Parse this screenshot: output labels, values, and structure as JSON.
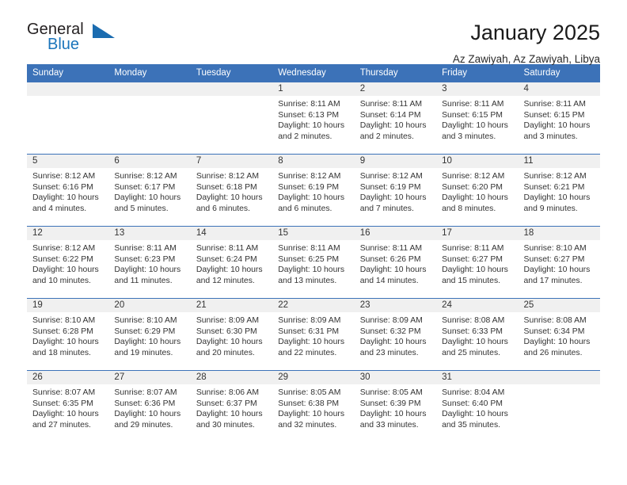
{
  "brand": {
    "name_part1": "General",
    "name_part2": "Blue",
    "triangle_color": "#1b6cb0",
    "blue_color": "#1b75bb"
  },
  "header": {
    "month_title": "January 2025",
    "location": "Az Zawiyah, Az Zawiyah, Libya"
  },
  "theme": {
    "header_blue": "#3c72b8",
    "band_gray": "#f0f0f0",
    "text": "#333333"
  },
  "calendar": {
    "weekday_headers": [
      "Sunday",
      "Monday",
      "Tuesday",
      "Wednesday",
      "Thursday",
      "Friday",
      "Saturday"
    ],
    "weeks": [
      [
        {
          "day": "",
          "lines": []
        },
        {
          "day": "",
          "lines": []
        },
        {
          "day": "",
          "lines": []
        },
        {
          "day": "1",
          "lines": [
            "Sunrise: 8:11 AM",
            "Sunset: 6:13 PM",
            "Daylight: 10 hours",
            "and 2 minutes."
          ]
        },
        {
          "day": "2",
          "lines": [
            "Sunrise: 8:11 AM",
            "Sunset: 6:14 PM",
            "Daylight: 10 hours",
            "and 2 minutes."
          ]
        },
        {
          "day": "3",
          "lines": [
            "Sunrise: 8:11 AM",
            "Sunset: 6:15 PM",
            "Daylight: 10 hours",
            "and 3 minutes."
          ]
        },
        {
          "day": "4",
          "lines": [
            "Sunrise: 8:11 AM",
            "Sunset: 6:15 PM",
            "Daylight: 10 hours",
            "and 3 minutes."
          ]
        }
      ],
      [
        {
          "day": "5",
          "lines": [
            "Sunrise: 8:12 AM",
            "Sunset: 6:16 PM",
            "Daylight: 10 hours",
            "and 4 minutes."
          ]
        },
        {
          "day": "6",
          "lines": [
            "Sunrise: 8:12 AM",
            "Sunset: 6:17 PM",
            "Daylight: 10 hours",
            "and 5 minutes."
          ]
        },
        {
          "day": "7",
          "lines": [
            "Sunrise: 8:12 AM",
            "Sunset: 6:18 PM",
            "Daylight: 10 hours",
            "and 6 minutes."
          ]
        },
        {
          "day": "8",
          "lines": [
            "Sunrise: 8:12 AM",
            "Sunset: 6:19 PM",
            "Daylight: 10 hours",
            "and 6 minutes."
          ]
        },
        {
          "day": "9",
          "lines": [
            "Sunrise: 8:12 AM",
            "Sunset: 6:19 PM",
            "Daylight: 10 hours",
            "and 7 minutes."
          ]
        },
        {
          "day": "10",
          "lines": [
            "Sunrise: 8:12 AM",
            "Sunset: 6:20 PM",
            "Daylight: 10 hours",
            "and 8 minutes."
          ]
        },
        {
          "day": "11",
          "lines": [
            "Sunrise: 8:12 AM",
            "Sunset: 6:21 PM",
            "Daylight: 10 hours",
            "and 9 minutes."
          ]
        }
      ],
      [
        {
          "day": "12",
          "lines": [
            "Sunrise: 8:12 AM",
            "Sunset: 6:22 PM",
            "Daylight: 10 hours",
            "and 10 minutes."
          ]
        },
        {
          "day": "13",
          "lines": [
            "Sunrise: 8:11 AM",
            "Sunset: 6:23 PM",
            "Daylight: 10 hours",
            "and 11 minutes."
          ]
        },
        {
          "day": "14",
          "lines": [
            "Sunrise: 8:11 AM",
            "Sunset: 6:24 PM",
            "Daylight: 10 hours",
            "and 12 minutes."
          ]
        },
        {
          "day": "15",
          "lines": [
            "Sunrise: 8:11 AM",
            "Sunset: 6:25 PM",
            "Daylight: 10 hours",
            "and 13 minutes."
          ]
        },
        {
          "day": "16",
          "lines": [
            "Sunrise: 8:11 AM",
            "Sunset: 6:26 PM",
            "Daylight: 10 hours",
            "and 14 minutes."
          ]
        },
        {
          "day": "17",
          "lines": [
            "Sunrise: 8:11 AM",
            "Sunset: 6:27 PM",
            "Daylight: 10 hours",
            "and 15 minutes."
          ]
        },
        {
          "day": "18",
          "lines": [
            "Sunrise: 8:10 AM",
            "Sunset: 6:27 PM",
            "Daylight: 10 hours",
            "and 17 minutes."
          ]
        }
      ],
      [
        {
          "day": "19",
          "lines": [
            "Sunrise: 8:10 AM",
            "Sunset: 6:28 PM",
            "Daylight: 10 hours",
            "and 18 minutes."
          ]
        },
        {
          "day": "20",
          "lines": [
            "Sunrise: 8:10 AM",
            "Sunset: 6:29 PM",
            "Daylight: 10 hours",
            "and 19 minutes."
          ]
        },
        {
          "day": "21",
          "lines": [
            "Sunrise: 8:09 AM",
            "Sunset: 6:30 PM",
            "Daylight: 10 hours",
            "and 20 minutes."
          ]
        },
        {
          "day": "22",
          "lines": [
            "Sunrise: 8:09 AM",
            "Sunset: 6:31 PM",
            "Daylight: 10 hours",
            "and 22 minutes."
          ]
        },
        {
          "day": "23",
          "lines": [
            "Sunrise: 8:09 AM",
            "Sunset: 6:32 PM",
            "Daylight: 10 hours",
            "and 23 minutes."
          ]
        },
        {
          "day": "24",
          "lines": [
            "Sunrise: 8:08 AM",
            "Sunset: 6:33 PM",
            "Daylight: 10 hours",
            "and 25 minutes."
          ]
        },
        {
          "day": "25",
          "lines": [
            "Sunrise: 8:08 AM",
            "Sunset: 6:34 PM",
            "Daylight: 10 hours",
            "and 26 minutes."
          ]
        }
      ],
      [
        {
          "day": "26",
          "lines": [
            "Sunrise: 8:07 AM",
            "Sunset: 6:35 PM",
            "Daylight: 10 hours",
            "and 27 minutes."
          ]
        },
        {
          "day": "27",
          "lines": [
            "Sunrise: 8:07 AM",
            "Sunset: 6:36 PM",
            "Daylight: 10 hours",
            "and 29 minutes."
          ]
        },
        {
          "day": "28",
          "lines": [
            "Sunrise: 8:06 AM",
            "Sunset: 6:37 PM",
            "Daylight: 10 hours",
            "and 30 minutes."
          ]
        },
        {
          "day": "29",
          "lines": [
            "Sunrise: 8:05 AM",
            "Sunset: 6:38 PM",
            "Daylight: 10 hours",
            "and 32 minutes."
          ]
        },
        {
          "day": "30",
          "lines": [
            "Sunrise: 8:05 AM",
            "Sunset: 6:39 PM",
            "Daylight: 10 hours",
            "and 33 minutes."
          ]
        },
        {
          "day": "31",
          "lines": [
            "Sunrise: 8:04 AM",
            "Sunset: 6:40 PM",
            "Daylight: 10 hours",
            "and 35 minutes."
          ]
        },
        {
          "day": "",
          "lines": []
        }
      ]
    ]
  }
}
